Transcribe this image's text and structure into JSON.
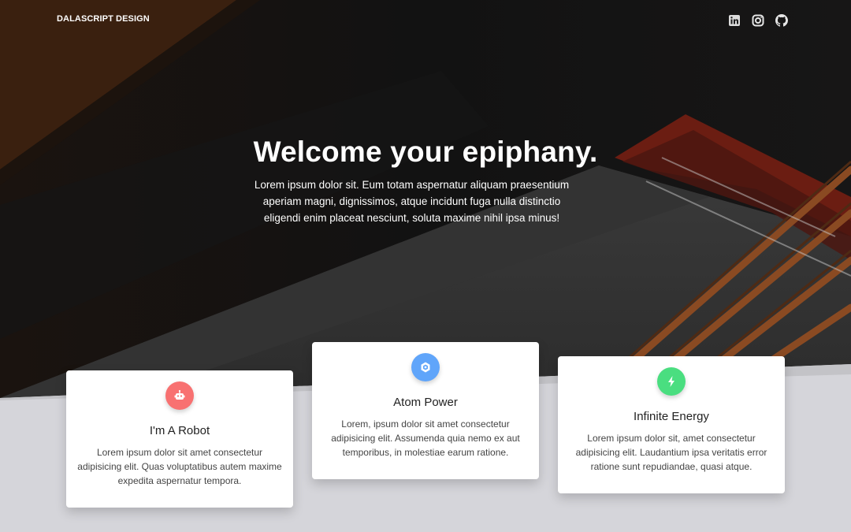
{
  "nav": {
    "brand": "DALASCRIPT DESIGN",
    "social": [
      {
        "name": "linkedin-icon"
      },
      {
        "name": "instagram-icon"
      },
      {
        "name": "github-icon"
      }
    ]
  },
  "hero": {
    "title": "Welcome your epiphany.",
    "text": "Lorem ipsum dolor sit. Eum totam aspernatur aliquam praesentium aperiam magni, dignissimos, atque incidunt fuga nulla distinctio eligendi enim placeat nesciunt, soluta maxime nihil ipsa minus!"
  },
  "cards": [
    {
      "title": "I'm A Robot",
      "text": "Lorem ipsum dolor sit amet consectetur adipisicing elit. Quas voluptatibus autem maxime expedita aspernatur tempora.",
      "icon": "robot-icon",
      "color": "#f87171"
    },
    {
      "title": "Atom Power",
      "text": "Lorem, ipsum dolor sit amet consectetur adipisicing elit. Assumenda quia nemo ex aut temporibus, in molestiae earum ratione.",
      "icon": "atom-icon",
      "color": "#60a5fa"
    },
    {
      "title": "Infinite Energy",
      "text": "Lorem ipsum dolor sit, amet consectetur adipisicing elit. Laudantium ipsa veritatis error ratione sunt repudiandae, quasi atque.",
      "icon": "bolt-icon",
      "color": "#4ade80"
    }
  ]
}
